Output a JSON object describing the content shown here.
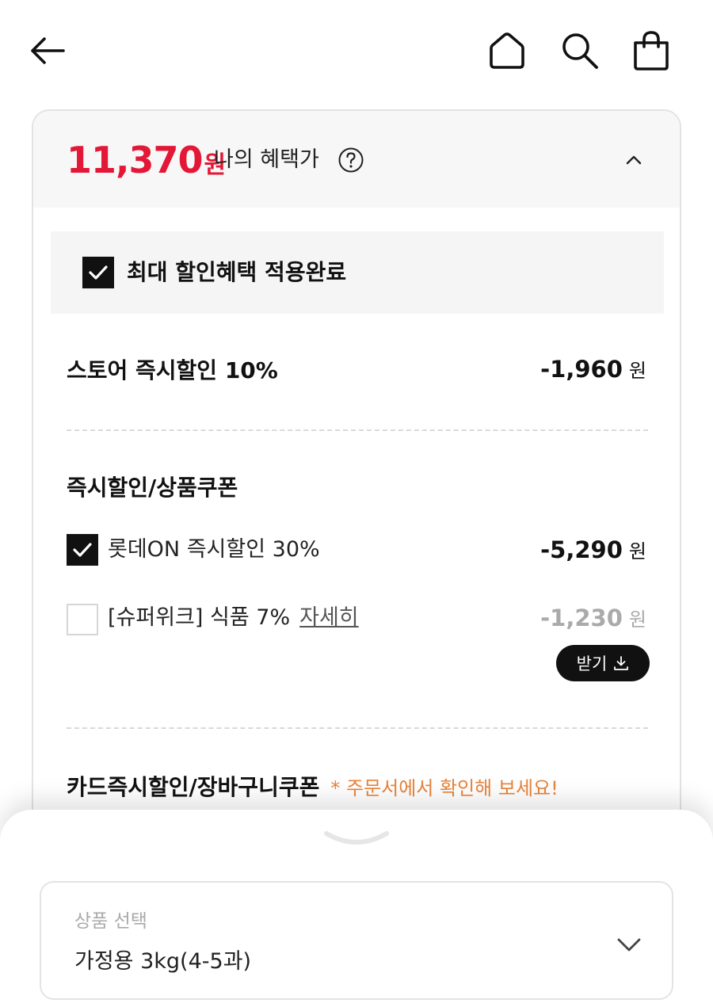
{
  "header": {
    "back_icon": "arrow-left-icon",
    "home_icon": "home-icon",
    "search_icon": "search-icon",
    "cart_icon": "shopping-bag-icon"
  },
  "benefit": {
    "price": "11,370",
    "price_unit": "원",
    "label": "나의 혜택가",
    "help_icon": "question-circle-icon",
    "collapse_icon": "chevron-up-icon",
    "applied_text": "최대 할인혜택 적용완료",
    "accent_color": "#e31837"
  },
  "store_discount": {
    "title": "스토어 즉시할인 10%",
    "amount": "-1,960",
    "unit": "원"
  },
  "coupons": {
    "title": "즉시할인/상품쿠폰",
    "items": [
      {
        "label": "롯데ON 즉시할인 30%",
        "amount": "-5,290",
        "unit": "원",
        "checked": true
      },
      {
        "label": "[슈퍼위크] 식품 7%",
        "link": "자세히",
        "amount": "-1,230",
        "unit": "원",
        "checked": false,
        "receive_label": "받기"
      }
    ]
  },
  "card_discount": {
    "title": "카드즉시할인/장바구니쿠폰",
    "notice": "* 주문서에서 확인해 보세요!",
    "notice_color": "#e8833a"
  },
  "option_sheet": {
    "label": "상품 선택",
    "value": "가정용 3kg(4-5과)"
  }
}
